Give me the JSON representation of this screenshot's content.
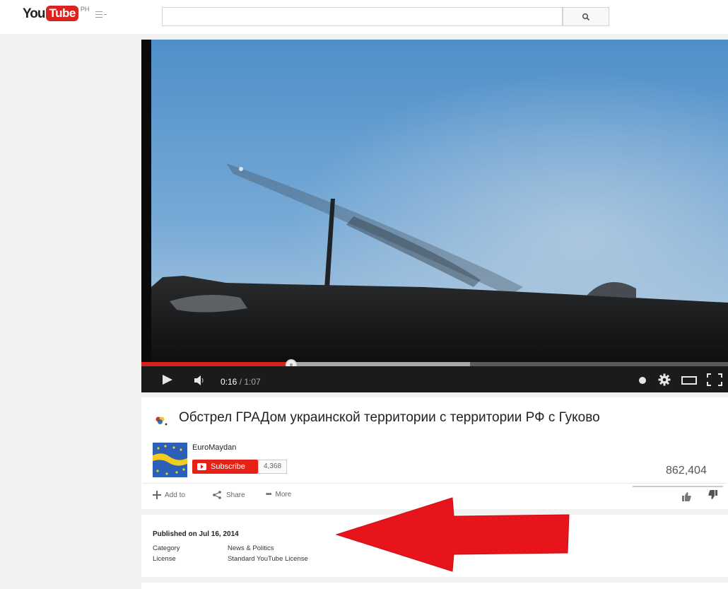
{
  "header": {
    "logo_you": "You",
    "logo_tube": "Tube",
    "country": "PH",
    "search_placeholder": ""
  },
  "player": {
    "current_time": "0:16",
    "duration": "/ 1:07",
    "played_fraction": 0.255,
    "loaded_fraction": 0.56
  },
  "video": {
    "title": "Обстрел ГРАДом украинской территории с территории РФ с Гуково",
    "channel": "EuroMaydan",
    "subscribe_label": "Subscribe",
    "subscriber_count": "4,368",
    "views": "862,404"
  },
  "actions": {
    "add_to": "Add to",
    "share": "Share",
    "more": "More"
  },
  "description": {
    "published": "Published on Jul 16, 2014",
    "rows": [
      {
        "label": "Category",
        "value": "News & Politics"
      },
      {
        "label": "License",
        "value": "Standard YouTube License"
      }
    ]
  },
  "colors": {
    "brand_red": "#e62117",
    "progress_red": "#d91e1e",
    "annotation_arrow": "#e8141b"
  },
  "icons": [
    "guide-menu-icon",
    "search-icon",
    "play-icon",
    "volume-icon",
    "annotations-icon",
    "settings-icon",
    "theater-mode-icon",
    "fullscreen-icon",
    "add-icon",
    "share-icon",
    "more-icon",
    "like-icon",
    "dislike-icon"
  ]
}
